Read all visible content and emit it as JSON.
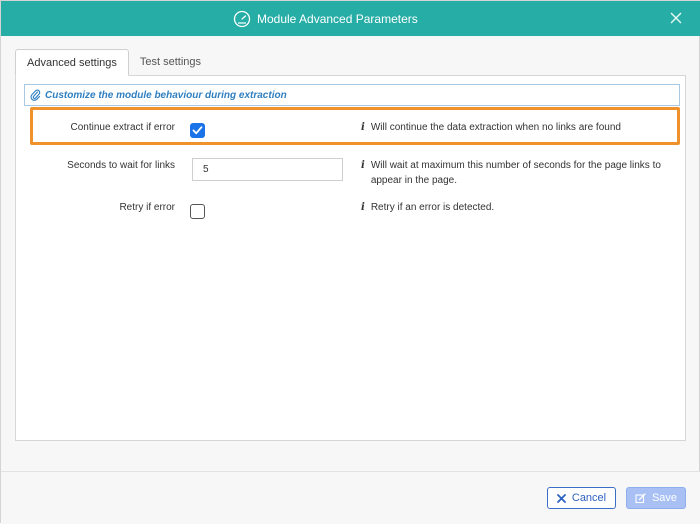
{
  "dialog": {
    "title": "Module Advanced Parameters",
    "title_icon": "speedometer-icon",
    "close_icon": "close-icon"
  },
  "tabs": [
    {
      "label": "Advanced settings",
      "active": true
    },
    {
      "label": "Test settings",
      "active": false
    }
  ],
  "section": {
    "icon": "paperclip-icon",
    "title": "Customize the module behaviour during extraction"
  },
  "fields": {
    "continue_extract": {
      "label": "Continue extract if error",
      "checked": true,
      "help": "Will continue the data extraction when no links are found"
    },
    "seconds_wait": {
      "label": "Seconds to wait for links",
      "value": "5",
      "help": "Will wait at maximum this number of seconds for the page links to appear in the page."
    },
    "retry": {
      "label": "Retry if error",
      "checked": false,
      "help": "Retry if an error is detected."
    }
  },
  "info_glyph": "i",
  "footer": {
    "cancel_label": "Cancel",
    "cancel_icon": "x-icon",
    "save_label": "Save",
    "save_icon": "edit-icon"
  },
  "colors": {
    "titlebar": "#26ada6",
    "highlight": "#f0922b",
    "section_title": "#2f7fc1",
    "checkbox_checked": "#1a73e8",
    "cancel": "#2d62c2",
    "save_bg": "#a8c0f4"
  }
}
